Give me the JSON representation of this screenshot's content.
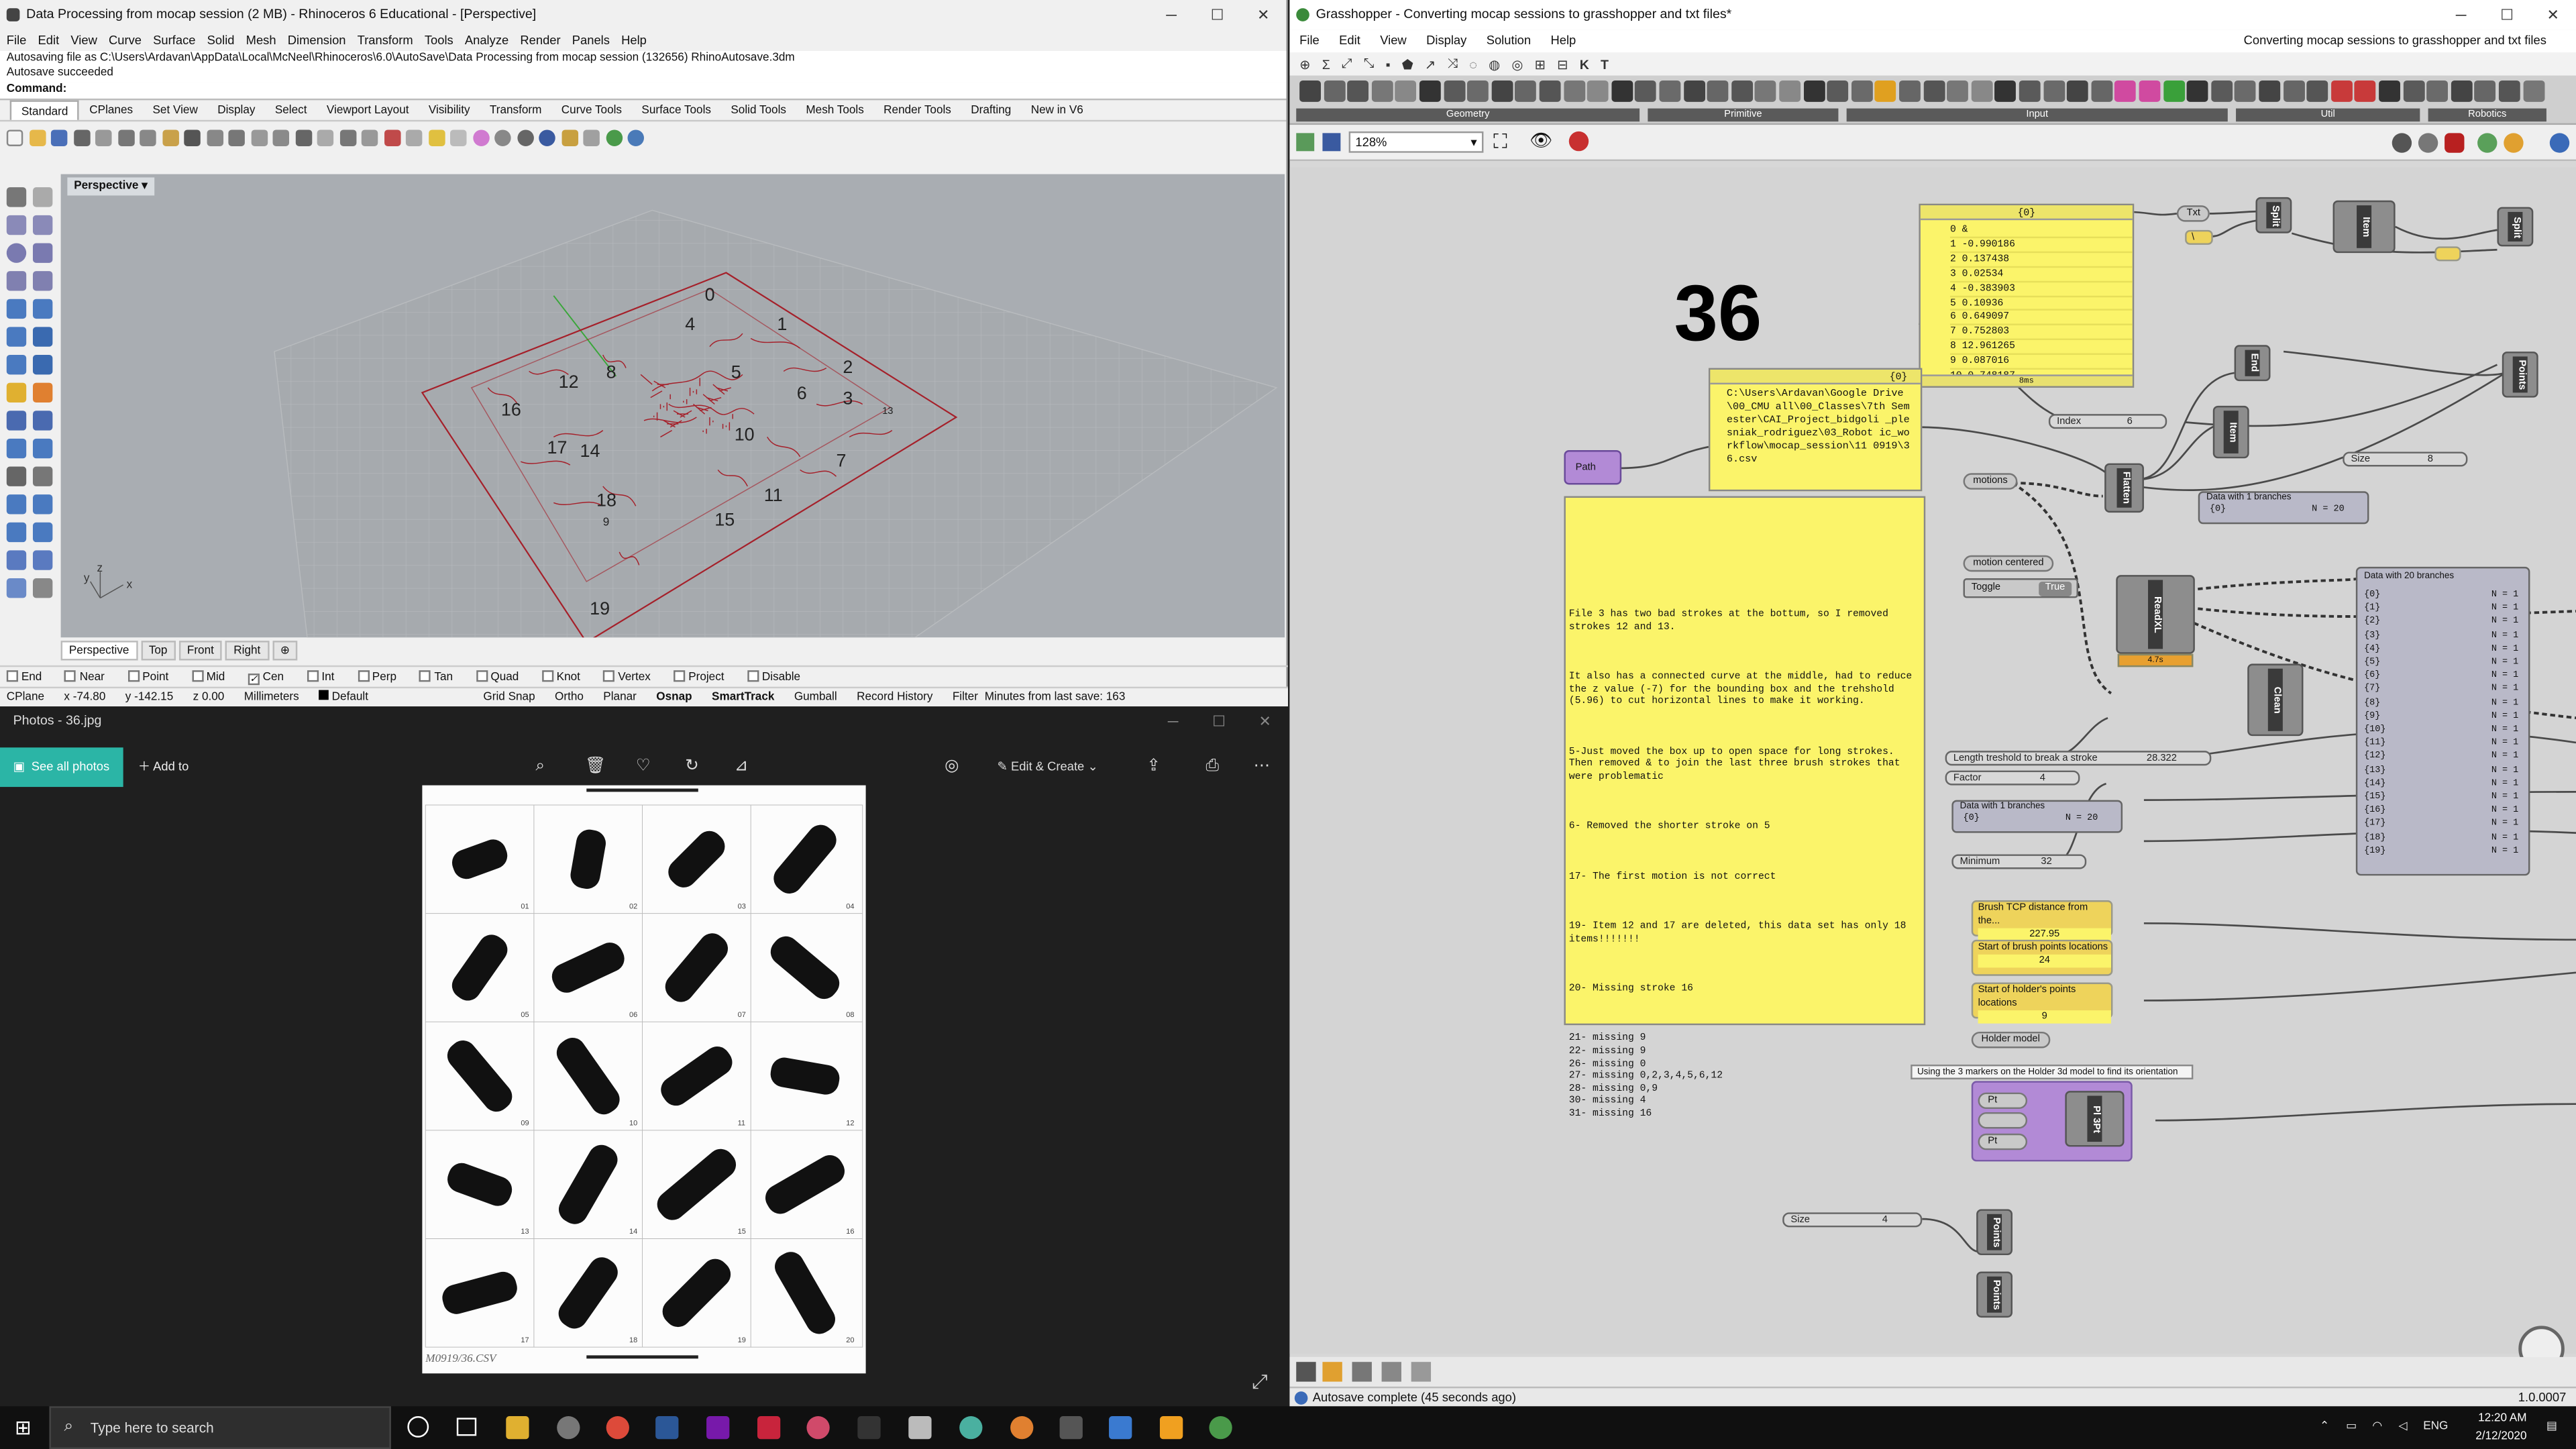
{
  "rhino": {
    "title": "Data Processing from mocap session (2 MB) - Rhinoceros 6 Educational - [Perspective]",
    "menu": [
      "File",
      "Edit",
      "View",
      "Curve",
      "Surface",
      "Solid",
      "Mesh",
      "Dimension",
      "Transform",
      "Tools",
      "Analyze",
      "Render",
      "Panels",
      "Help"
    ],
    "history_line1": "Autosaving file as C:\\Users\\Ardavan\\AppData\\Local\\McNeel\\Rhinoceros\\6.0\\AutoSave\\Data Processing from mocap session (132656) RhinoAutosave.3dm",
    "history_line2": "Autosave succeeded",
    "command_label": "Command:",
    "tabs": [
      "Standard",
      "CPlanes",
      "Set View",
      "Display",
      "Select",
      "Viewport Layout",
      "Visibility",
      "Transform",
      "Curve Tools",
      "Surface Tools",
      "Solid Tools",
      "Mesh Tools",
      "Render Tools",
      "Drafting",
      "New in V6"
    ],
    "viewport_label": "Perspective",
    "viewport_numbers": [
      "0",
      "1",
      "2",
      "3",
      "4",
      "5",
      "6",
      "7",
      "8",
      "9",
      "10",
      "11",
      "12",
      "13",
      "14",
      "15",
      "16",
      "17",
      "18",
      "19"
    ],
    "axis_x": "x",
    "axis_y": "y",
    "axis_z": "z",
    "viewport_tabs": [
      "Perspective",
      "Top",
      "Front",
      "Right"
    ],
    "osnaps": [
      "End",
      "Near",
      "Point",
      "Mid",
      "Cen",
      "Int",
      "Perp",
      "Tan",
      "Quad",
      "Knot",
      "Vertex",
      "Project",
      "Disable"
    ],
    "status": {
      "cplane": "CPlane",
      "x": "x -74.80",
      "y": "y -142.15",
      "z": "z 0.00",
      "units": "Millimeters",
      "layer": "Default",
      "modes": [
        "Grid Snap",
        "Ortho",
        "Planar",
        "Osnap",
        "SmartTrack",
        "Gumball",
        "Record History",
        "Filter"
      ],
      "last_save": "Minutes from last save: 163"
    }
  },
  "photos": {
    "title": "Photos - 36.jpg",
    "see_all": "See all photos",
    "add_to": "Add to",
    "edit_create": "Edit & Create",
    "sheet_numbers": [
      "01",
      "02",
      "03",
      "04",
      "05",
      "06",
      "07",
      "08",
      "09",
      "10",
      "11",
      "12",
      "13",
      "14",
      "15",
      "16",
      "17",
      "18",
      "19",
      "20"
    ],
    "sheet_caption": "M0919/36.CSV"
  },
  "grasshopper": {
    "title": "Grasshopper - Converting mocap sessions to grasshopper and txt files*",
    "menu": [
      "File",
      "Edit",
      "View",
      "Display",
      "Solution",
      "Help"
    ],
    "doc_name": "Converting mocap sessions to grasshopper and txt files",
    "icon_row": [
      "⊕",
      "Σ",
      "⤢",
      "⤡",
      "▪",
      "⬟",
      "↗",
      "⤨",
      "◌",
      "◍",
      "◎",
      "⊞",
      "⊟",
      "K",
      "T"
    ],
    "ribbon_groups": [
      "Geometry",
      "Primitive",
      "Input",
      "Util",
      "Robotics"
    ],
    "zoom": "128%",
    "big_number": "36",
    "panel_values_head": "{0}",
    "panel_values": [
      "0 &",
      "1 -0.990186",
      "2 0.137438",
      "3 0.02534",
      "4 -0.383903",
      "5 0.10936",
      "6 0.649097",
      "7 0.752803",
      "8 12.961265",
      "9 0.087016",
      "10 0.748187"
    ],
    "panel_values_foot": "8ms",
    "path_panel_head": "{0}",
    "path_panel_text": "C:\\Users\\Ardavan\\Google Drive\\00_CMU all\\00_Classes\\7th Semester\\CAI_Project_bidgoli _plesniak_rodriguez\\03_Robot ic_workflow\\mocap_session\\11 0919\\36.csv",
    "path_param": "Path",
    "notes": [
      "File 3 has two bad strokes at the bottum, so I removed strokes 12 and 13.",
      "It also has a connected curve at the middle, had to reduce the z value (-7) for the bounding box and the trehshold (5.96) to cut horizontal lines to make it working.",
      "5-Just moved the box up to open space for long strokes. Then removed & to join the last three brush strokes that were problematic",
      "6- Removed the shorter stroke on 5",
      "17- The first motion is not correct",
      "19- Item 12 and 17 are deleted, this data set has only 18 items!!!!!!!",
      "20- Missing stroke 16",
      "21- missing 9\n22- missing 9\n26- missing 0\n27- missing 0,2,3,4,5,6,12\n28- missing 0,9\n30- missing 4\n31- missing 16"
    ],
    "components": {
      "txt": "Txt",
      "split1": "Split",
      "item1": "Item",
      "split2": "Split",
      "slash": "\\",
      "end": "End",
      "points1": "Points",
      "item2": "Item",
      "index_label": "Index",
      "index_value": "6",
      "size_label": "Size",
      "size_value": "8",
      "motions": "motions",
      "flatten": "Flatten",
      "data1_title": "Data with 1 branches",
      "data1_left": "{0}",
      "data1_right": "N = 20",
      "motion_centered": "motion centered",
      "toggle_label": "Toggle",
      "toggle_value": "True",
      "readxl": "ReadXL",
      "readxl_time": "4.7s",
      "clean": "Clean",
      "length_label": "Length treshold to break a stroke",
      "length_value": "28.322",
      "factor_label": "Factor",
      "factor_value": "4",
      "data2_title": "Data with 1 branches",
      "data2_left": "{0}",
      "data2_right": "N = 20",
      "minimum_label": "Minimum",
      "minimum_value": "32",
      "tcp_label": "Brush TCP distance from the...",
      "tcp_value": "227.95",
      "brush_start_label": "Start of brush points locations",
      "brush_start_value": "24",
      "holder_start_label": "Start of holder's points locations",
      "holder_start_value": "9",
      "holder_model": "Holder model",
      "tooltip": "Using the 3 markers on the Holder 3d model to find its orientation",
      "pl3pt": "Pl 3Pt",
      "pt": "Pt",
      "size2_label": "Size",
      "size2_value": "4",
      "points2": "Points",
      "points3": "Points",
      "data20_title": "Data with 20 branches",
      "data20_rows": [
        "{0}",
        "{1}",
        "{2}",
        "{3}",
        "{4}",
        "{5}",
        "{6}",
        "{7}",
        "{8}",
        "{9}",
        "{10}",
        "{11}",
        "{12}",
        "{13}",
        "{14}",
        "{15}",
        "{16}",
        "{17}",
        "{18}",
        "{19}"
      ],
      "data20_n": "N = 1"
    },
    "status": "Autosave complete (45 seconds ago)",
    "version": "1.0.0007"
  },
  "taskbar": {
    "search_placeholder": "Type here to search",
    "lang": "ENG",
    "time": "12:20 AM",
    "date": "2/12/2020"
  },
  "colors": {
    "photos_accent": "#2bb5a6",
    "panel_yellow": "#fbf46a",
    "curve_red": "#a5202a"
  }
}
